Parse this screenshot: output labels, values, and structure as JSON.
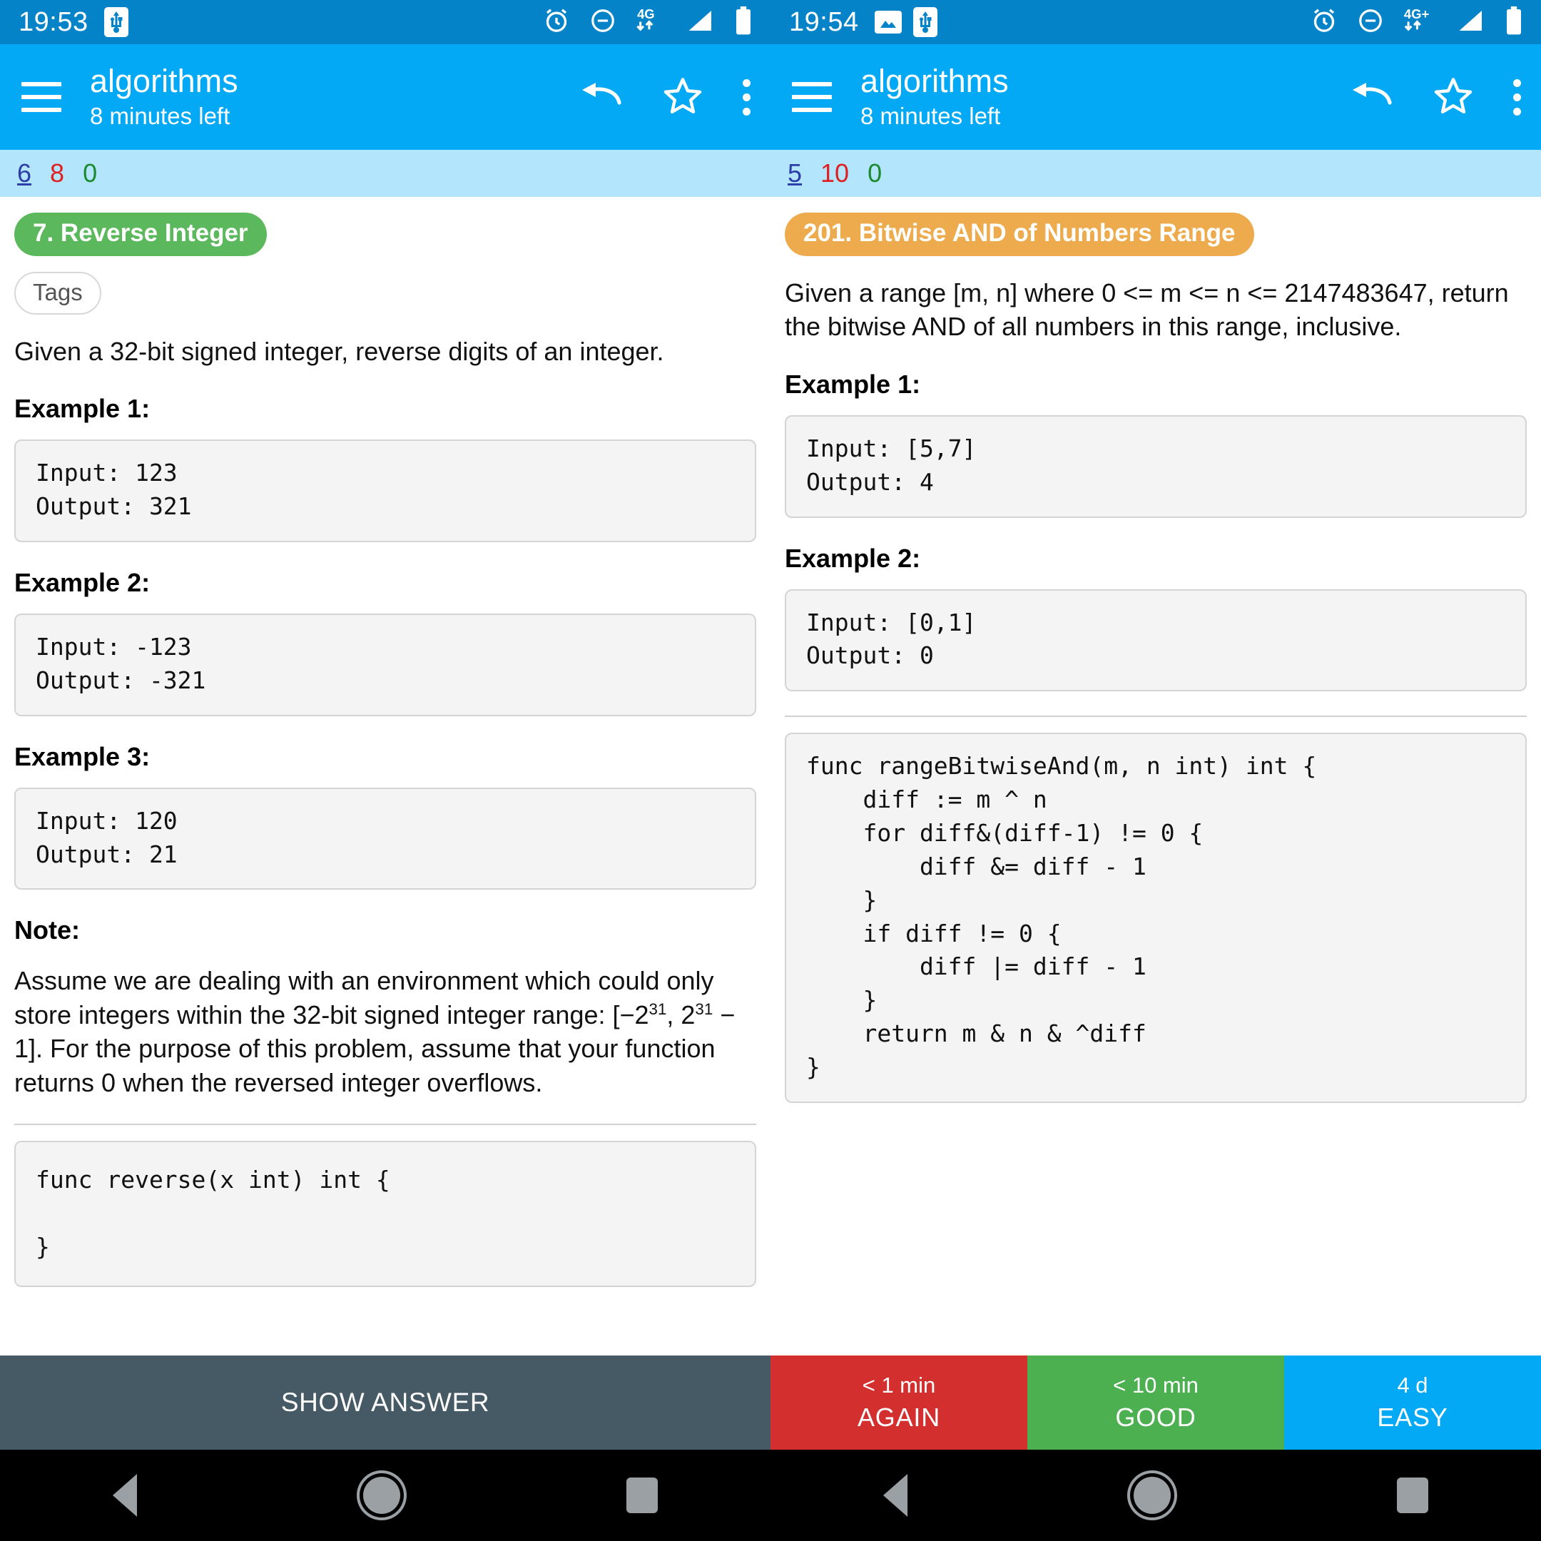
{
  "panes": [
    {
      "status": {
        "time": "19:53",
        "left_icons": [
          "usb-icon"
        ],
        "right_icons": [
          "alarm-icon",
          "do-not-disturb-icon",
          "mobile-data-4g-icon",
          "signal-icon",
          "battery-icon"
        ],
        "network_label": "4G"
      },
      "appbar": {
        "menu_icon": "hamburger-icon",
        "title": "algorithms",
        "subtitle": "8 minutes left",
        "actions": [
          "undo-icon",
          "star-icon",
          "overflow-menu-icon"
        ]
      },
      "counts": {
        "new": "6",
        "learning": "8",
        "due": "0"
      },
      "card": {
        "badge": "7. Reverse Integer",
        "badge_color": "#5cb85c",
        "tags_label": "Tags",
        "description": "Given a 32-bit signed integer, reverse digits of an integer.",
        "examples": [
          {
            "heading": "Example 1:",
            "code": "Input: 123\nOutput: 321"
          },
          {
            "heading": "Example 2:",
            "code": "Input: -123\nOutput: -321"
          },
          {
            "heading": "Example 3:",
            "code": "Input: 120\nOutput: 21"
          }
        ],
        "note_heading": "Note:",
        "note_html": "Assume we are dealing with an environment which could only store integers within the 32-bit signed integer range: [&minus;2<sup>31</sup>, 2<sup>31</sup> &minus; 1]. For the purpose of this problem, assume that your function returns 0 when the reversed integer overflows.",
        "answer_code": "func reverse(x int) int {\n\n}"
      }
    },
    {
      "status": {
        "time": "19:54",
        "left_icons": [
          "photo-icon",
          "usb-icon"
        ],
        "right_icons": [
          "alarm-icon",
          "do-not-disturb-icon",
          "mobile-data-4g-plus-icon",
          "signal-icon",
          "battery-icon"
        ],
        "network_label": "4G+"
      },
      "appbar": {
        "menu_icon": "hamburger-icon",
        "title": "algorithms",
        "subtitle": "8 minutes left",
        "actions": [
          "undo-icon",
          "star-icon",
          "overflow-menu-icon"
        ]
      },
      "counts": {
        "new": "5",
        "learning": "10",
        "due": "0"
      },
      "card": {
        "badge": "201. Bitwise AND of Numbers Range",
        "badge_color": "#eeab4d",
        "description": "Given a range [m, n] where 0 <= m <= n <= 2147483647, return the bitwise AND of all numbers in this range, inclusive.",
        "examples": [
          {
            "heading": "Example 1:",
            "code": "Input: [5,7]\nOutput: 4"
          },
          {
            "heading": "Example 2:",
            "code": "Input: [0,1]\nOutput: 0"
          }
        ],
        "answer_code": "func rangeBitwiseAnd(m, n int) int {\n    diff := m ^ n\n    for diff&(diff-1) != 0 {\n        diff &= diff - 1\n    }\n    if diff != 0 {\n        diff |= diff - 1\n    }\n    return m & n & ^diff\n}"
      }
    }
  ],
  "bottom": {
    "show_answer": "SHOW ANSWER",
    "ease_buttons": [
      {
        "time": "< 1 min",
        "label": "AGAIN",
        "color": "#d32f2f"
      },
      {
        "time": "< 10 min",
        "label": "GOOD",
        "color": "#4caf50"
      },
      {
        "time": "4 d",
        "label": "EASY",
        "color": "#03a9f4"
      }
    ]
  },
  "navbar": {
    "buttons": [
      "back-icon",
      "home-icon",
      "recents-icon"
    ]
  }
}
